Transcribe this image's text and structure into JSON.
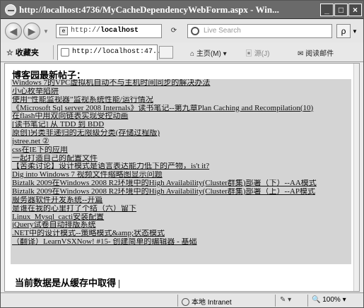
{
  "window": {
    "title": "http://localhost:4736/MyCacheDependencyWebForm.aspx - Win...",
    "min_label": "_",
    "max_label": "□",
    "close_label": "×"
  },
  "nav": {
    "back_glyph": "◀",
    "forward_glyph": "▶",
    "address_prefix": "http://",
    "address_host": "localhost",
    "search_placeholder": "Live Search",
    "search_glyph": "ρ"
  },
  "tabbar": {
    "favorites_label": "收藏夹",
    "tab_title": "http://localhost:47...",
    "home_label": "主页(M)",
    "feeds_label": "源(J)",
    "read_mail_label": "阅读邮件"
  },
  "content": {
    "heading": "博客园最新帖子：",
    "posts": [
      "Windows 7的VPC虚拟机自动不与主机时间同步的解决办法",
      "小心枚举陷阱",
      "使用“性能监视器”监视系统性能/运行情况",
      "《Microsoft Sql server 2008 Internals》读书笔记--第九章Plan Caching and Recompilation(10)",
      "在flash中用双向链表实现受控动画",
      "[读书笔记] 从 TDD 到 BDD",
      "原创]另类非递归的无限级分类(存储过程版)",
      "jstree.net ②",
      "css在IE下的应用",
      "一起打造自己的配置文件",
      "【苦柔讨论】设计模式是语言表达能力低下的产物，is't it?",
      "Dig into Windows 7 视频文件缩略图显示问题",
      "Biztalk 2009在Windows 2008 R2环境中的High Availability(Cluster群集)部署（下）--AA模式",
      "Biztalk 2009在Windows 2008 R2环境中的High Availability(Cluster群集)部署（上）--AP模式",
      "服务器软件开发系统--开篇",
      "是谁在我的心里打了个结（六）留下",
      "Linux_Mysql_cacti安装配置",
      "jQuery试卷自动排版系统",
      ".NET中的设计模式--策略模式&amp;状态模式",
      "（翻译）LearnVSXNow! #15- 创建简单的编辑器 - 基础"
    ],
    "cache_message": "当前数据是从缓存中取得"
  },
  "status": {
    "zone": "本地 Intranet",
    "zoom": "100%"
  }
}
